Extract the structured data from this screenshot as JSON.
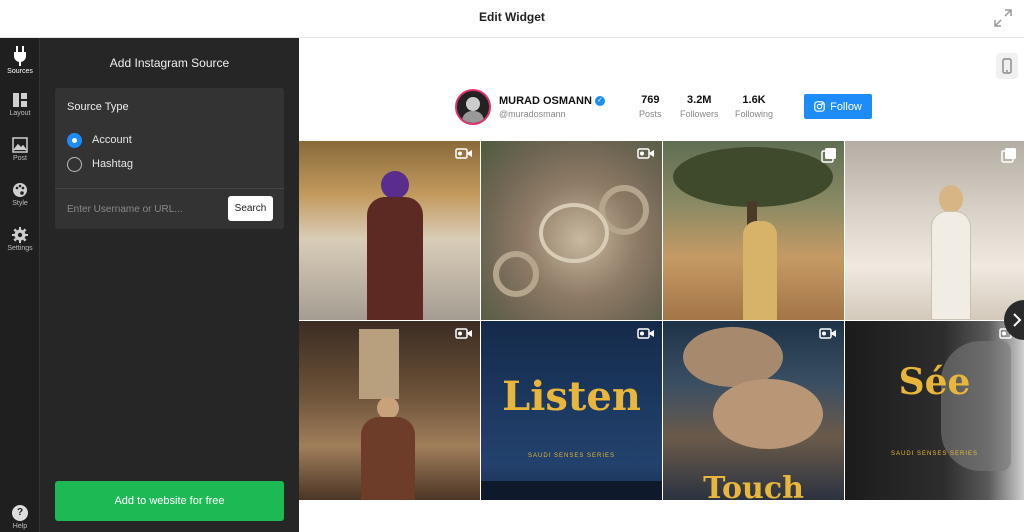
{
  "header": {
    "title": "Edit Widget"
  },
  "rail": {
    "items": [
      {
        "label": "Sources",
        "icon": "plug-icon"
      },
      {
        "label": "Layout",
        "icon": "layout-icon"
      },
      {
        "label": "Post",
        "icon": "image-icon"
      },
      {
        "label": "Style",
        "icon": "palette-icon"
      },
      {
        "label": "Settings",
        "icon": "gear-icon"
      }
    ],
    "help_label": "Help"
  },
  "panel": {
    "heading": "Add Instagram Source",
    "source_type_label": "Source Type",
    "options": [
      {
        "label": "Account",
        "selected": true
      },
      {
        "label": "Hashtag",
        "selected": false
      }
    ],
    "input_placeholder": "Enter Username or URL...",
    "search_label": "Search",
    "add_button": "Add to website for free"
  },
  "profile": {
    "name": "MURAD OSMANN",
    "handle": "@muradosmann",
    "stats": [
      {
        "value": "769",
        "label": "Posts"
      },
      {
        "value": "3.2M",
        "label": "Followers"
      },
      {
        "value": "1.6K",
        "label": "Following"
      }
    ],
    "follow_label": "Follow"
  },
  "posts": [
    {
      "type": "video-icon",
      "caption": ""
    },
    {
      "type": "video-icon",
      "caption": ""
    },
    {
      "type": "gallery-icon",
      "caption": ""
    },
    {
      "type": "gallery-icon",
      "caption": ""
    },
    {
      "type": "video-icon",
      "caption": ""
    },
    {
      "type": "video-icon",
      "caption": "Listen",
      "sub": "SAUDI SENSES SERIES"
    },
    {
      "type": "video-icon",
      "caption": "Touch"
    },
    {
      "type": "video-icon",
      "caption": "Sée",
      "sub": "SAUDI SENSES SERIES"
    }
  ],
  "colors": {
    "accent": "#1d8cf8",
    "cta": "#1db954",
    "panel": "#262626",
    "rail": "#1f1f1f"
  }
}
